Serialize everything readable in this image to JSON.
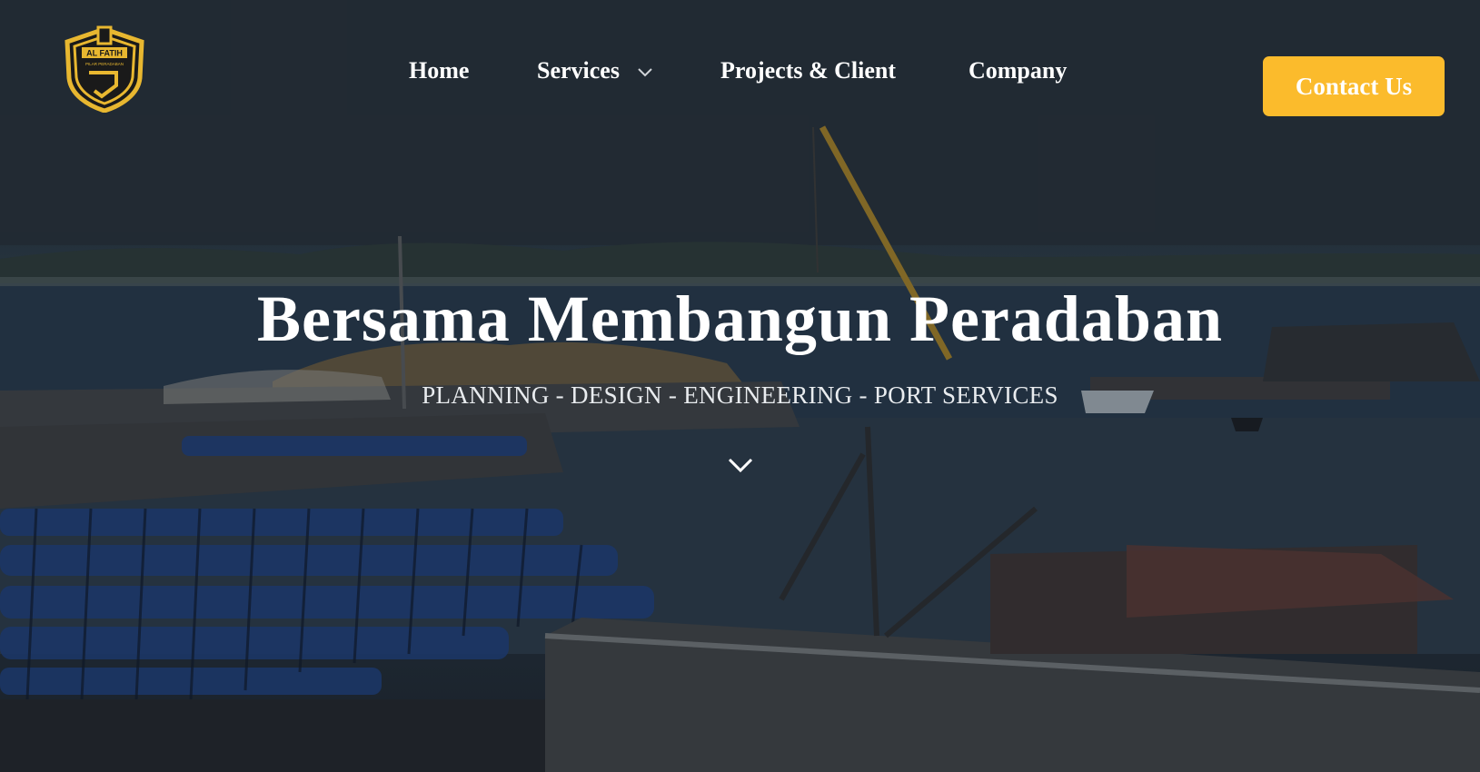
{
  "brand": {
    "logo_text": "AL FATIH",
    "logo_subtext": "PILAR PERADABAN",
    "accent_color": "#fbbb2c"
  },
  "nav": {
    "items": [
      {
        "label": "Home"
      },
      {
        "label": "Services",
        "icon": "chevron-down-icon"
      },
      {
        "label": "Projects & Client"
      },
      {
        "label": "Company"
      }
    ],
    "contact_label": "Contact Us"
  },
  "hero": {
    "title": "Bersama Membangun Peradaban",
    "subtitle": "PLANNING - DESIGN - ENGINEERING - PORT SERVICES",
    "scroll_icon": "chevron-down-icon"
  }
}
